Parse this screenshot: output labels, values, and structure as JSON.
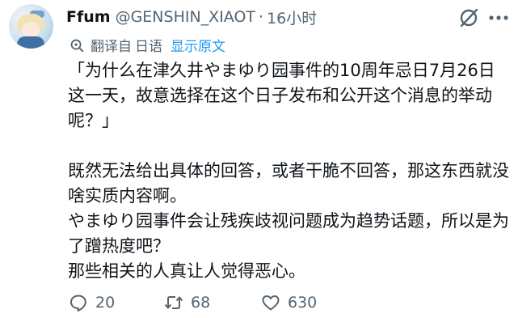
{
  "tweet": {
    "display_name": "Ffum",
    "handle": "@GENSHIN_XIAOT",
    "separator": "·",
    "time": "16小时",
    "translation": {
      "label": "翻译自",
      "source_language": "日语",
      "show_original": "显示原文"
    },
    "paragraphs": [
      "「为什么在津久井やまゆり园事件的10周年忌日7月26日这一天，故意选择在这个日子发布和公开这个消息的举动呢？」",
      "",
      "既然无法给出具体的回答，或者干脆不回答，那这东西就没啥实质内容啊。",
      "やまゆり园事件会让残疾歧视问题成为趋势话题，所以是为了蹭热度吧？",
      "那些相关的人真让人觉得恶心。"
    ],
    "actions": {
      "replies": "20",
      "retweets": "68",
      "likes": "630"
    }
  }
}
